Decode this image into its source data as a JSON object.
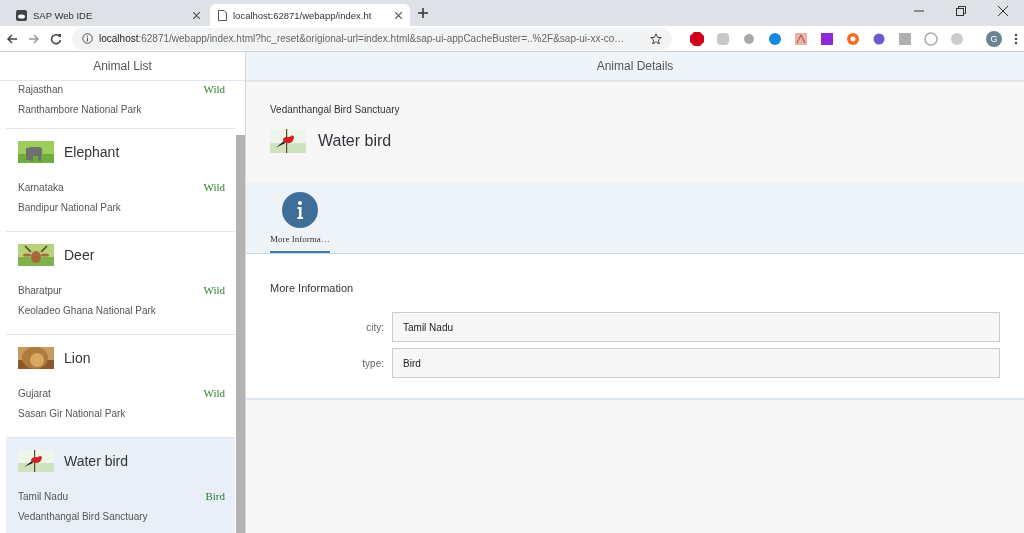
{
  "browser": {
    "tabs": [
      {
        "title": "SAP Web IDE",
        "selected": false
      },
      {
        "title": "localhost:62871/webapp/index.ht",
        "selected": true
      }
    ],
    "address": {
      "host": "localhost",
      "rest": ":62871/webapp/index.html?hc_reset&origional-url=index.html&sap-ui-appCacheBuster=..%2F&sap-ui-xx-co…"
    },
    "profile": "G"
  },
  "master": {
    "title": "Animal List",
    "items": [
      {
        "kind": "cut",
        "region": "Rajasthan",
        "park": "Ranthambore National Park",
        "status": "Wild",
        "selected": false
      },
      {
        "kind": "full",
        "name": "Elephant",
        "region": "Karnataka",
        "park": "Bandipur National Park",
        "status": "Wild",
        "selected": false
      },
      {
        "kind": "full",
        "name": "Deer",
        "region": "Bharatpur",
        "park": "Keoladeo Ghana National Park",
        "status": "Wild",
        "selected": false
      },
      {
        "kind": "full",
        "name": "Lion",
        "region": "Gujarat",
        "park": "Sasan Gir National Park",
        "status": "Wild",
        "selected": false
      },
      {
        "kind": "full",
        "name": "Water bird",
        "region": "Tamil Nadu",
        "park": "Vedanthangal Bird Sanctuary",
        "status": "Bird",
        "selected": true
      }
    ]
  },
  "detail": {
    "title": "Animal Details",
    "header": {
      "subtitle": "Vedanthangal Bird Sanctuary",
      "title": "Water bird"
    },
    "tabs": [
      {
        "label": "More Informa…",
        "selected": true
      }
    ],
    "section": {
      "title": "More Information",
      "fields": [
        {
          "label": "city:",
          "value": "Tamil Nadu"
        },
        {
          "label": "type:",
          "value": "Bird"
        }
      ]
    }
  }
}
